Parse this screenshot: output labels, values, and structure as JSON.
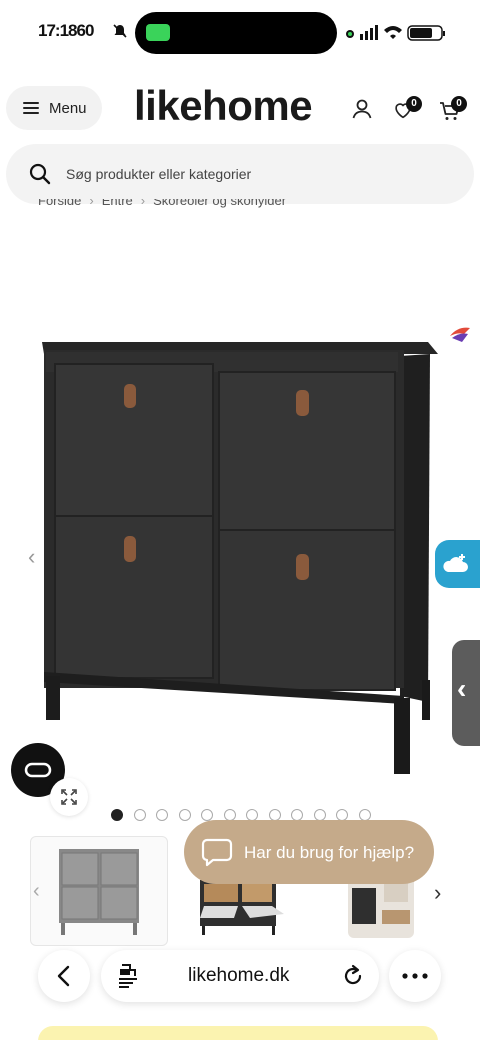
{
  "status_bar": {
    "time": "17:18",
    "time_suffix": "60"
  },
  "header": {
    "menu_label": "Menu",
    "logo": "likehome",
    "wishlist_count": "0",
    "cart_count": "0"
  },
  "search": {
    "placeholder": "Søg produkter eller kategorier"
  },
  "breadcrumb": {
    "items": [
      "Forside",
      "Entré",
      "Skoreoler og skohylder"
    ]
  },
  "gallery": {
    "slide_count": 12,
    "active_index": 0
  },
  "help_chat": {
    "label": "Har du brug for hjælp?"
  },
  "browser": {
    "url": "likehome.dk"
  },
  "colors": {
    "accent_help": "#c5aa8a",
    "weather_widget": "#2aa2cf",
    "product_body": "#2b2b2b",
    "leather_handle": "#8a5a3c"
  }
}
